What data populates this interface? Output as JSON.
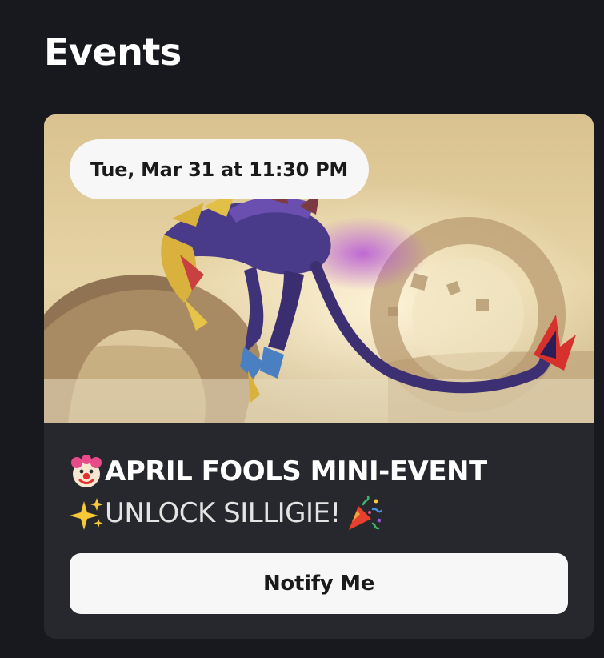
{
  "section": {
    "title": "Events"
  },
  "event": {
    "date_label": "Tue, Mar 31 at 11:30 PM",
    "title_line_1": "APRIL FOOLS MINI-EVENT",
    "title_line_2": "UNLOCK SILLIGIE!",
    "emoji_1": "clown-face",
    "emoji_2": "sparkles",
    "emoji_3": "party-popper",
    "banner_image": "event-banner-dragon-creature",
    "notify_label": "Notify Me"
  },
  "colors": {
    "background": "#18191e",
    "card": "#27282d",
    "pill": "#f7f7f7",
    "button": "#f7f7f7",
    "text_primary": "#ffffff",
    "text_dark": "#1a1a1a"
  }
}
